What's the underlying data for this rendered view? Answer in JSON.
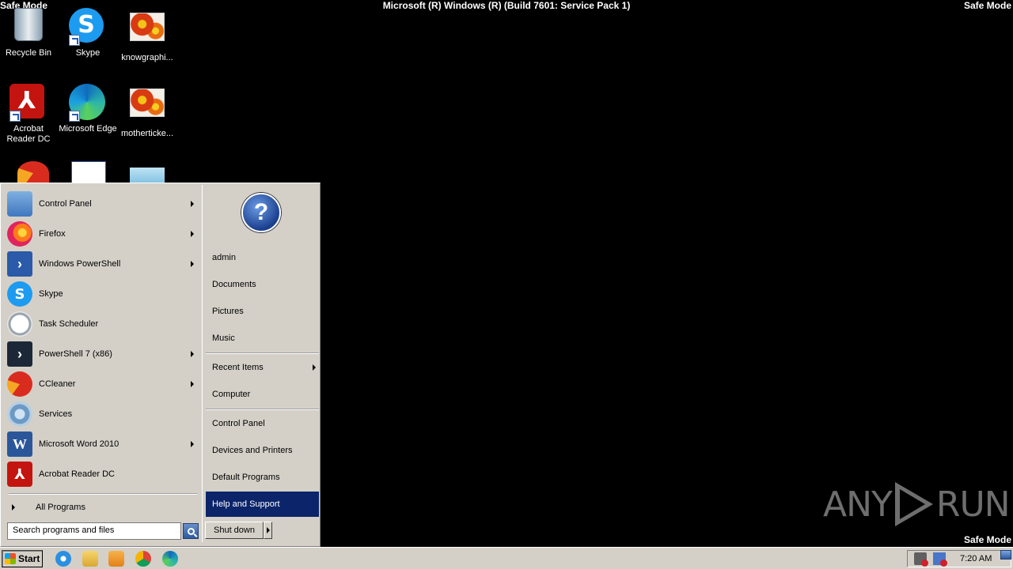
{
  "screen": {
    "safe_mode": "Safe Mode",
    "os_title": "Microsoft (R) Windows (R) (Build 7601: Service Pack 1)"
  },
  "desktop_icons": [
    {
      "label": "Recycle Bin",
      "icon": "recycle-bin-icon"
    },
    {
      "label": "Skype",
      "icon": "skype-icon"
    },
    {
      "label": "knowgraphi...",
      "icon": "image-file-icon"
    },
    {
      "label": "Acrobat Reader DC",
      "icon": "acrobat-icon"
    },
    {
      "label": "Microsoft Edge",
      "icon": "edge-icon"
    },
    {
      "label": "motherticke...",
      "icon": "image-file-icon"
    }
  ],
  "start_menu": {
    "programs": [
      {
        "label": "Control Panel",
        "icon": "control-panel-icon",
        "submenu": true
      },
      {
        "label": "Firefox",
        "icon": "firefox-icon",
        "submenu": true
      },
      {
        "label": "Windows PowerShell",
        "icon": "powershell-icon",
        "submenu": true
      },
      {
        "label": "Skype",
        "icon": "skype-icon",
        "submenu": false
      },
      {
        "label": "Task Scheduler",
        "icon": "task-scheduler-icon",
        "submenu": false
      },
      {
        "label": "PowerShell 7 (x86)",
        "icon": "powershell7-icon",
        "submenu": true
      },
      {
        "label": "CCleaner",
        "icon": "ccleaner-icon",
        "submenu": true
      },
      {
        "label": "Services",
        "icon": "services-icon",
        "submenu": false
      },
      {
        "label": "Microsoft Word 2010",
        "icon": "word-icon",
        "submenu": true
      },
      {
        "label": "Acrobat Reader DC",
        "icon": "acrobat-icon",
        "submenu": false
      }
    ],
    "all_programs": "All Programs",
    "search_placeholder": "Search programs and files",
    "right_links": [
      {
        "label": "admin"
      },
      {
        "label": "Documents"
      },
      {
        "label": "Pictures"
      },
      {
        "label": "Music"
      },
      {
        "label": "Recent Items",
        "submenu": true
      },
      {
        "label": "Computer"
      },
      {
        "label": "Control Panel"
      },
      {
        "label": "Devices and Printers"
      },
      {
        "label": "Default Programs"
      },
      {
        "label": "Help and Support",
        "active": true
      }
    ],
    "shutdown_label": "Shut down"
  },
  "taskbar": {
    "start_label": "Start",
    "quick_launch": [
      "internet-explorer-icon",
      "explorer-icon",
      "media-player-icon",
      "chrome-icon",
      "edge-icon"
    ],
    "clock": "7:20 AM"
  },
  "watermark": {
    "left": "ANY",
    "right": "RUN"
  }
}
